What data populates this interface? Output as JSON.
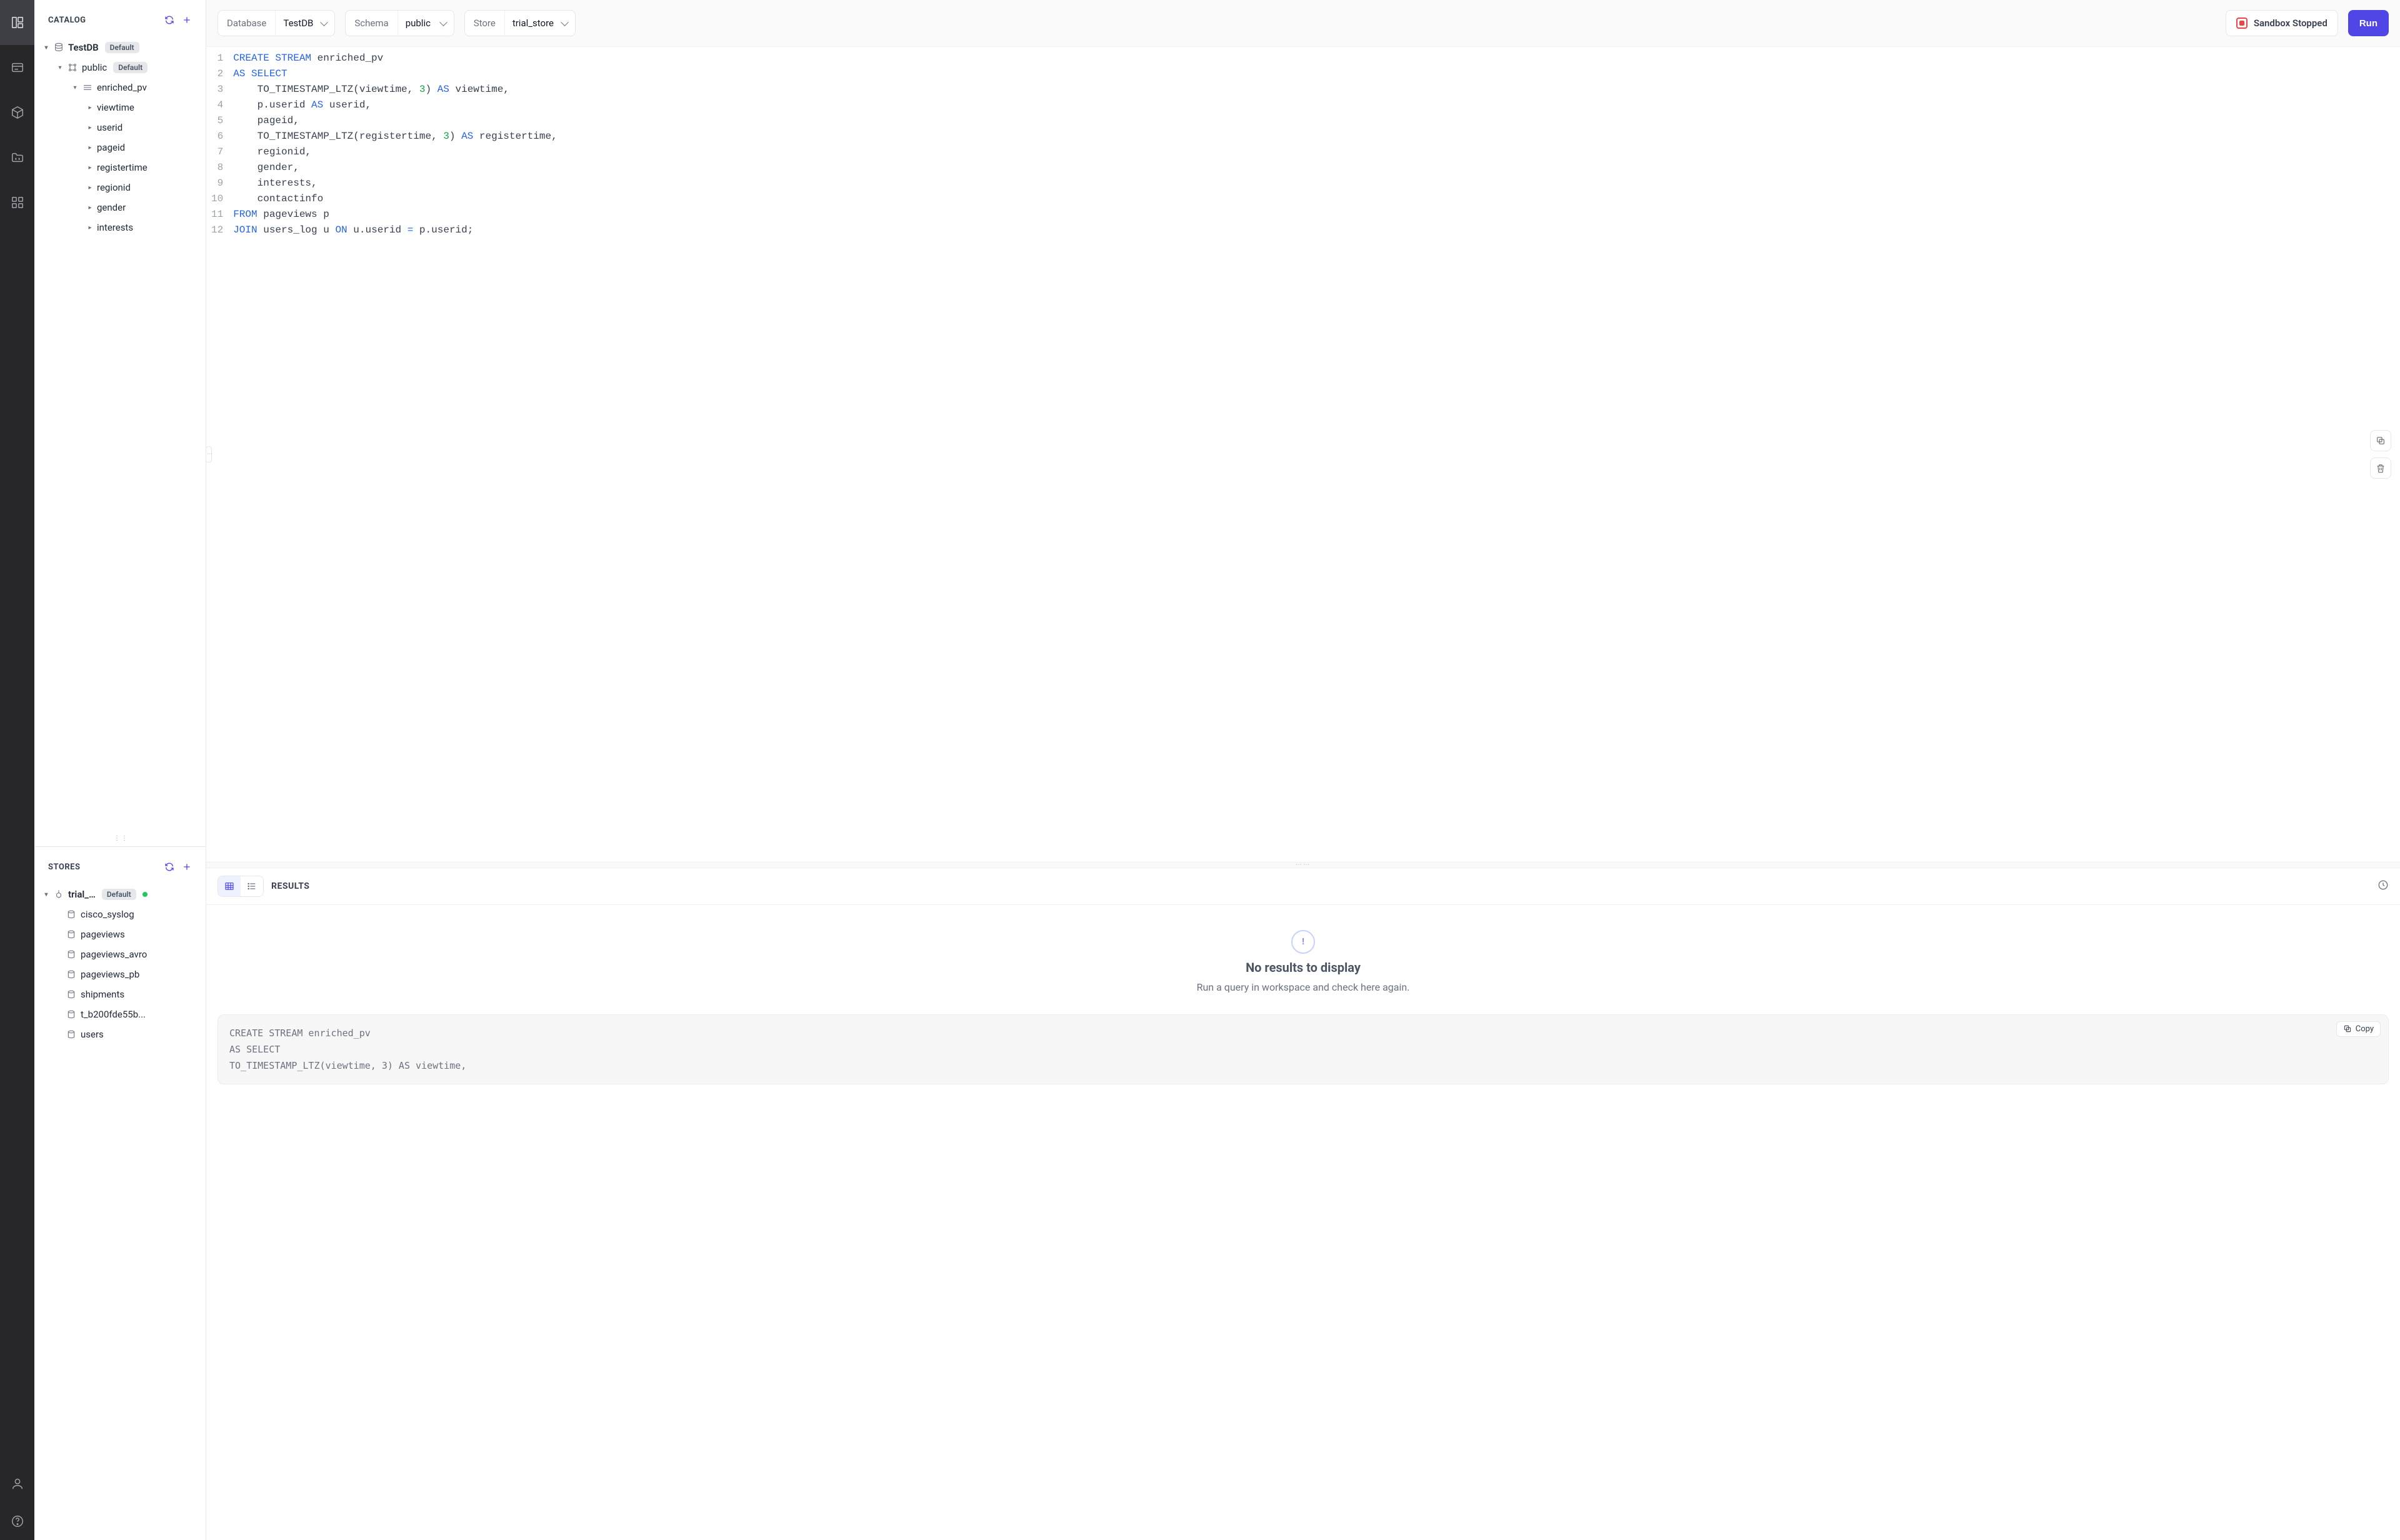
{
  "catalog": {
    "title": "CATALOG",
    "db": {
      "name": "TestDB",
      "badge": "Default"
    },
    "schema": {
      "name": "public",
      "badge": "Default"
    },
    "stream": {
      "name": "enriched_pv"
    },
    "columns": [
      "viewtime",
      "userid",
      "pageid",
      "registertime",
      "regionid",
      "gender",
      "interests"
    ]
  },
  "stores": {
    "title": "STORES",
    "store": {
      "name": "trial_…",
      "badge": "Default"
    },
    "topics": [
      "cisco_syslog",
      "pageviews",
      "pageviews_avro",
      "pageviews_pb",
      "shipments",
      "t_b200fde55b...",
      "users"
    ]
  },
  "toolbar": {
    "database": {
      "label": "Database",
      "value": "TestDB"
    },
    "schema": {
      "label": "Schema",
      "value": "public"
    },
    "store": {
      "label": "Store",
      "value": "trial_store"
    },
    "sandbox": "Sandbox Stopped",
    "run": "Run"
  },
  "editor": {
    "lines": [
      [
        [
          "kw",
          "CREATE"
        ],
        [
          "sp",
          " "
        ],
        [
          "kw",
          "STREAM"
        ],
        [
          "sp",
          " "
        ],
        [
          "id",
          "enriched_pv"
        ]
      ],
      [
        [
          "kw",
          "AS"
        ],
        [
          "sp",
          " "
        ],
        [
          "kw",
          "SELECT"
        ]
      ],
      [
        [
          "sp",
          "    "
        ],
        [
          "id",
          "TO_TIMESTAMP_LTZ"
        ],
        [
          "pn",
          "("
        ],
        [
          "id",
          "viewtime"
        ],
        [
          "pn",
          ", "
        ],
        [
          "num",
          "3"
        ],
        [
          "pn",
          ") "
        ],
        [
          "kw",
          "AS"
        ],
        [
          "sp",
          " "
        ],
        [
          "id",
          "viewtime"
        ],
        [
          "pn",
          ","
        ]
      ],
      [
        [
          "sp",
          "    "
        ],
        [
          "id",
          "p"
        ],
        [
          "pn",
          "."
        ],
        [
          "id",
          "userid"
        ],
        [
          "sp",
          " "
        ],
        [
          "kw",
          "AS"
        ],
        [
          "sp",
          " "
        ],
        [
          "id",
          "userid"
        ],
        [
          "pn",
          ","
        ]
      ],
      [
        [
          "sp",
          "    "
        ],
        [
          "id",
          "pageid"
        ],
        [
          "pn",
          ","
        ]
      ],
      [
        [
          "sp",
          "    "
        ],
        [
          "id",
          "TO_TIMESTAMP_LTZ"
        ],
        [
          "pn",
          "("
        ],
        [
          "id",
          "registertime"
        ],
        [
          "pn",
          ", "
        ],
        [
          "num",
          "3"
        ],
        [
          "pn",
          ") "
        ],
        [
          "kw",
          "AS"
        ],
        [
          "sp",
          " "
        ],
        [
          "id",
          "registertime"
        ],
        [
          "pn",
          ","
        ]
      ],
      [
        [
          "sp",
          "    "
        ],
        [
          "id",
          "regionid"
        ],
        [
          "pn",
          ","
        ]
      ],
      [
        [
          "sp",
          "    "
        ],
        [
          "id",
          "gender"
        ],
        [
          "pn",
          ","
        ]
      ],
      [
        [
          "sp",
          "    "
        ],
        [
          "id",
          "interests"
        ],
        [
          "pn",
          ","
        ]
      ],
      [
        [
          "sp",
          "    "
        ],
        [
          "id",
          "contactinfo"
        ]
      ],
      [
        [
          "kw",
          "FROM"
        ],
        [
          "sp",
          " "
        ],
        [
          "id",
          "pageviews p"
        ]
      ],
      [
        [
          "kw",
          "JOIN"
        ],
        [
          "sp",
          " "
        ],
        [
          "id",
          "users_log u"
        ],
        [
          "sp",
          " "
        ],
        [
          "kw",
          "ON"
        ],
        [
          "sp",
          " "
        ],
        [
          "id",
          "u"
        ],
        [
          "pn",
          "."
        ],
        [
          "id",
          "userid"
        ],
        [
          "sp",
          " "
        ],
        [
          "op",
          "="
        ],
        [
          "sp",
          " "
        ],
        [
          "id",
          "p"
        ],
        [
          "pn",
          "."
        ],
        [
          "id",
          "userid"
        ],
        [
          "pn",
          ";"
        ]
      ]
    ]
  },
  "results": {
    "title": "RESULTS",
    "empty_title": "No results to display",
    "empty_sub": "Run a query in workspace and check here again.",
    "copy": "Copy",
    "snippet": [
      "CREATE STREAM enriched_pv",
      "AS SELECT",
      "    TO_TIMESTAMP_LTZ(viewtime, 3) AS viewtime,"
    ]
  }
}
